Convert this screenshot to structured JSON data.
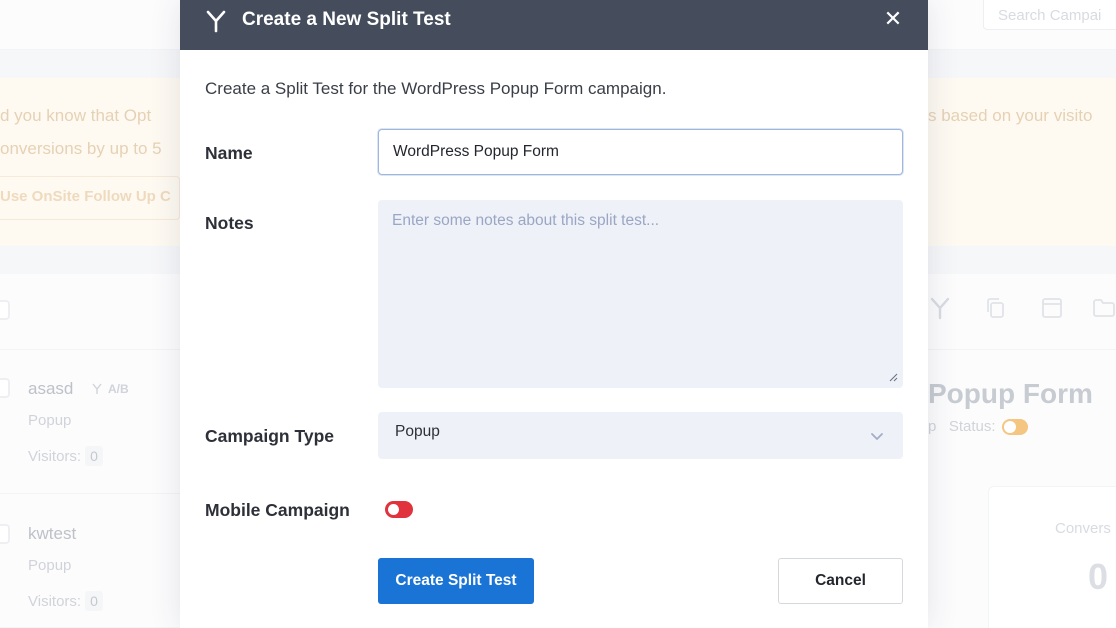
{
  "background": {
    "search_placeholder": "Search Campai",
    "alert": {
      "left_line1": "d you know that Opt",
      "left_line2": "onversions by up to 5",
      "right_line1": "s based on your visito",
      "link": "Use OnSite Follow Up C"
    },
    "campaigns": [
      {
        "title": "asasd",
        "badge": "A/B",
        "type": "Popup",
        "visitors_label": "Visitors:",
        "visitors": "0"
      },
      {
        "title": "kwtest",
        "type": "Popup",
        "visitors_label": "Visitors:",
        "visitors": "0"
      }
    ],
    "detail": {
      "title": "Popup Form",
      "type_fragment": "p",
      "status_label": "Status:",
      "conversions_label": "Convers",
      "conversions_value": "0"
    }
  },
  "modal": {
    "title": "Create a New Split Test",
    "close_symbol": "✕",
    "description": "Create a Split Test for the WordPress Popup Form campaign.",
    "name_label": "Name",
    "name_value": "WordPress Popup Form",
    "notes_label": "Notes",
    "notes_placeholder": "Enter some notes about this split test...",
    "campaign_type_label": "Campaign Type",
    "campaign_type_value": "Popup",
    "mobile_label": "Mobile Campaign",
    "mobile_enabled": false,
    "primary_button": "Create Split Test",
    "cancel_button": "Cancel"
  },
  "colors": {
    "header_bg": "#454c5b",
    "primary": "#1a74d6",
    "toggle_off": "#e0333d",
    "field_bg": "#eef1f8"
  },
  "icons": {
    "header": "split-test-icon",
    "close": "close-icon",
    "select": "chevron-down-icon"
  }
}
